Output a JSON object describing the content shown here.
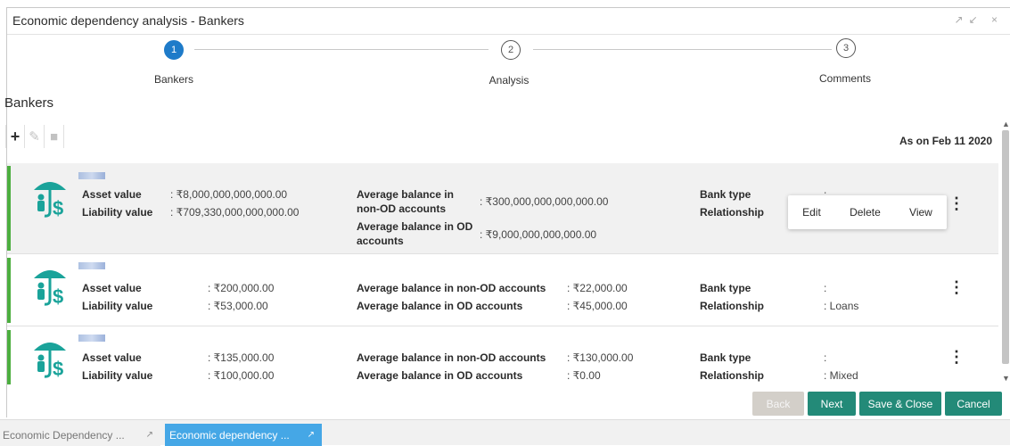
{
  "window": {
    "title": "Economic dependency analysis - Bankers",
    "controls": "↗↙ ×"
  },
  "stepper": {
    "steps": [
      {
        "number": "1",
        "label": "Bankers",
        "state": "active"
      },
      {
        "number": "2",
        "label": "Analysis",
        "state": "pending"
      },
      {
        "number": "3",
        "label": "Comments",
        "state": "pending"
      }
    ]
  },
  "section": {
    "title": "Bankers"
  },
  "toolbar": {
    "add_icon": "+",
    "edit_icon": "✎",
    "delete_icon": "■",
    "as_on": "As on Feb 11 2020"
  },
  "bankers": [
    {
      "asset_label": "Asset value",
      "asset_value": ": ₹8,000,000,000,000.00",
      "liability_label": "Liability value",
      "liability_value": ": ₹709,330,000,000,000.00",
      "avg_non_od_label_1": "Average balance in",
      "avg_non_od_label_2": "non-OD accounts",
      "avg_non_od_value": ": ₹300,000,000,000,000.00",
      "avg_od_label_1": "Average balance in OD",
      "avg_od_label_2": "accounts",
      "avg_od_value": ": ₹9,000,000,000,000.00",
      "bank_type_label": "Bank type",
      "bank_type_value": ":",
      "relationship_label": "Relationship",
      "relationship_value": ""
    },
    {
      "asset_label": "Asset value",
      "asset_value": ": ₹200,000.00",
      "liability_label": "Liability value",
      "liability_value": ": ₹53,000.00",
      "avg_non_od_label": "Average balance in non-OD accounts",
      "avg_non_od_value": ": ₹22,000.00",
      "avg_od_label": "Average balance in OD accounts",
      "avg_od_value": ": ₹45,000.00",
      "bank_type_label": "Bank type",
      "bank_type_value": ":",
      "relationship_label": "Relationship",
      "relationship_value": ": Loans"
    },
    {
      "asset_label": "Asset value",
      "asset_value": ": ₹135,000.00",
      "liability_label": "Liability value",
      "liability_value": ": ₹100,000.00",
      "avg_non_od_label": "Average balance in non-OD accounts",
      "avg_non_od_value": ": ₹130,000.00",
      "avg_od_label": "Average balance in OD accounts",
      "avg_od_value": ": ₹0.00",
      "bank_type_label": "Bank type",
      "bank_type_value": ":",
      "relationship_label": "Relationship",
      "relationship_value": ": Mixed"
    }
  ],
  "kebab_icon": "⋮",
  "context_menu": {
    "edit": "Edit",
    "delete": "Delete",
    "view": "View"
  },
  "footer": {
    "back": "Back",
    "next": "Next",
    "save_close": "Save & Close",
    "cancel": "Cancel"
  },
  "taskbar": {
    "tabs": [
      {
        "label": "Economic Dependency ...",
        "expand_icon": "↗"
      },
      {
        "label": "Economic dependency ...",
        "expand_icon": "↗"
      }
    ]
  },
  "colors": {
    "accent": "#1e7bc9",
    "primary_button": "#238a78",
    "status_bar": "#4cae3f",
    "active_task": "#45a7e6",
    "icon_teal": "#1aa39a"
  }
}
